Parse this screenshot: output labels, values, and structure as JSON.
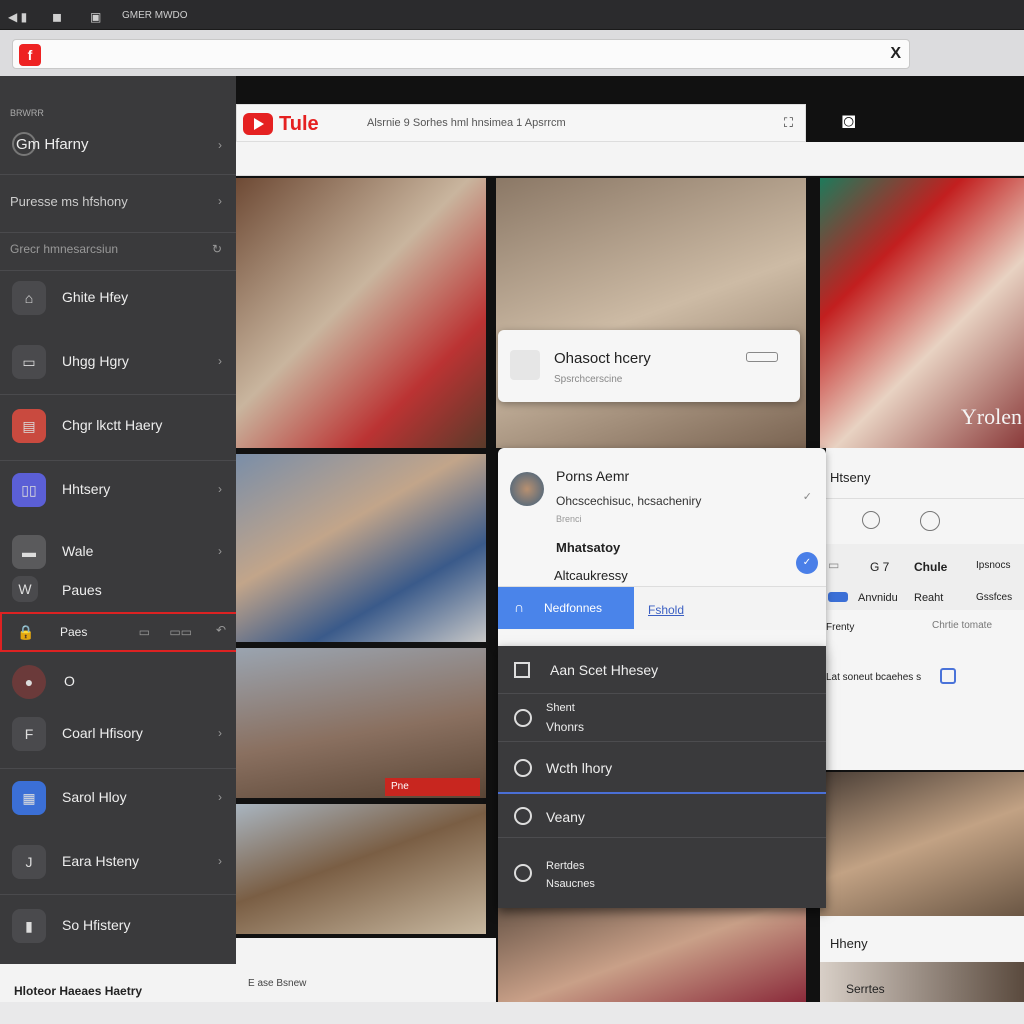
{
  "topbar": {
    "title": "GMER MWDO"
  },
  "address": {
    "favicon": "f",
    "close": "X"
  },
  "sidebar": {
    "section_top": "BRWRR",
    "items_top": [
      {
        "label": "Gm Hfarny"
      },
      {
        "label": "Puresse ms hfshony"
      },
      {
        "label": "Grecr hmnesarcsiun"
      }
    ],
    "items": [
      {
        "label": "Ghite Hfey",
        "icon": "bag-icon"
      },
      {
        "label": "Uhgg Hgry",
        "icon": "tv-icon"
      },
      {
        "label": "Chgr lkctt Haery",
        "icon": "store-icon"
      },
      {
        "label": "Hhtsery",
        "icon": "book-icon"
      },
      {
        "label": "Wale",
        "icon": "folder-icon"
      },
      {
        "label": "Paues",
        "icon": "w-icon"
      },
      {
        "label": "Paes",
        "icon": "lock-icon"
      },
      {
        "label": "O",
        "icon": "avatar-icon"
      },
      {
        "label": "Coarl Hfisory",
        "icon": "phone-icon"
      },
      {
        "label": "Sarol Hloy",
        "icon": "calendar-icon"
      },
      {
        "label": "Eara Hsteny",
        "icon": "j-icon"
      },
      {
        "label": "So Hfistery",
        "icon": "tablet-icon"
      }
    ],
    "footer": "Hloteor Haeaes Haetry"
  },
  "youtube": {
    "brand": "Tule",
    "search_text": "Alsrnie 9 Sorhes hml hnsimea 1 Apsrrcm",
    "video_icon": "⛶"
  },
  "popup_top": {
    "title": "Ohasoct hcery",
    "subtitle": "Spsrchcerscine"
  },
  "popup_menu": {
    "account_name": "Porns Aemr",
    "account_sub": "Ohcscechisuc, hcsacheniry",
    "account_tiny": "Brenci",
    "item1": "Mhatsatoy",
    "item2": "Altcaukressy",
    "tab_active": "Nedfonnes",
    "tab_link": "Fshold",
    "dark_rows": [
      {
        "line1": "Aan Scet Hhesey",
        "line2": ""
      },
      {
        "line1": "Shent",
        "line2": "Vhonrs"
      },
      {
        "line1": "Wcth lhory",
        "line2": ""
      },
      {
        "line1": "Veany",
        "line2": ""
      },
      {
        "line1": "Rertdes",
        "line2": "Nsaucnes"
      }
    ]
  },
  "right_panel": {
    "overlay_text": "Yrolen",
    "title": "Htseny",
    "stats": {
      "a": "G 7",
      "b": "Chule",
      "c": "Ipsnocs"
    },
    "stats2": {
      "a": "Anvnidu",
      "b": "Reaht",
      "c": "Gssfces"
    },
    "meta1": "Frenty",
    "meta2": "Chrtie tomate",
    "meta3": "Lat soneut bcaehes s",
    "history_label": "Hheny",
    "bottom_label": "Serrtes"
  },
  "bottom_bar": {
    "text": "E ase Bsnew"
  },
  "thumbnail_badge": "Pne"
}
